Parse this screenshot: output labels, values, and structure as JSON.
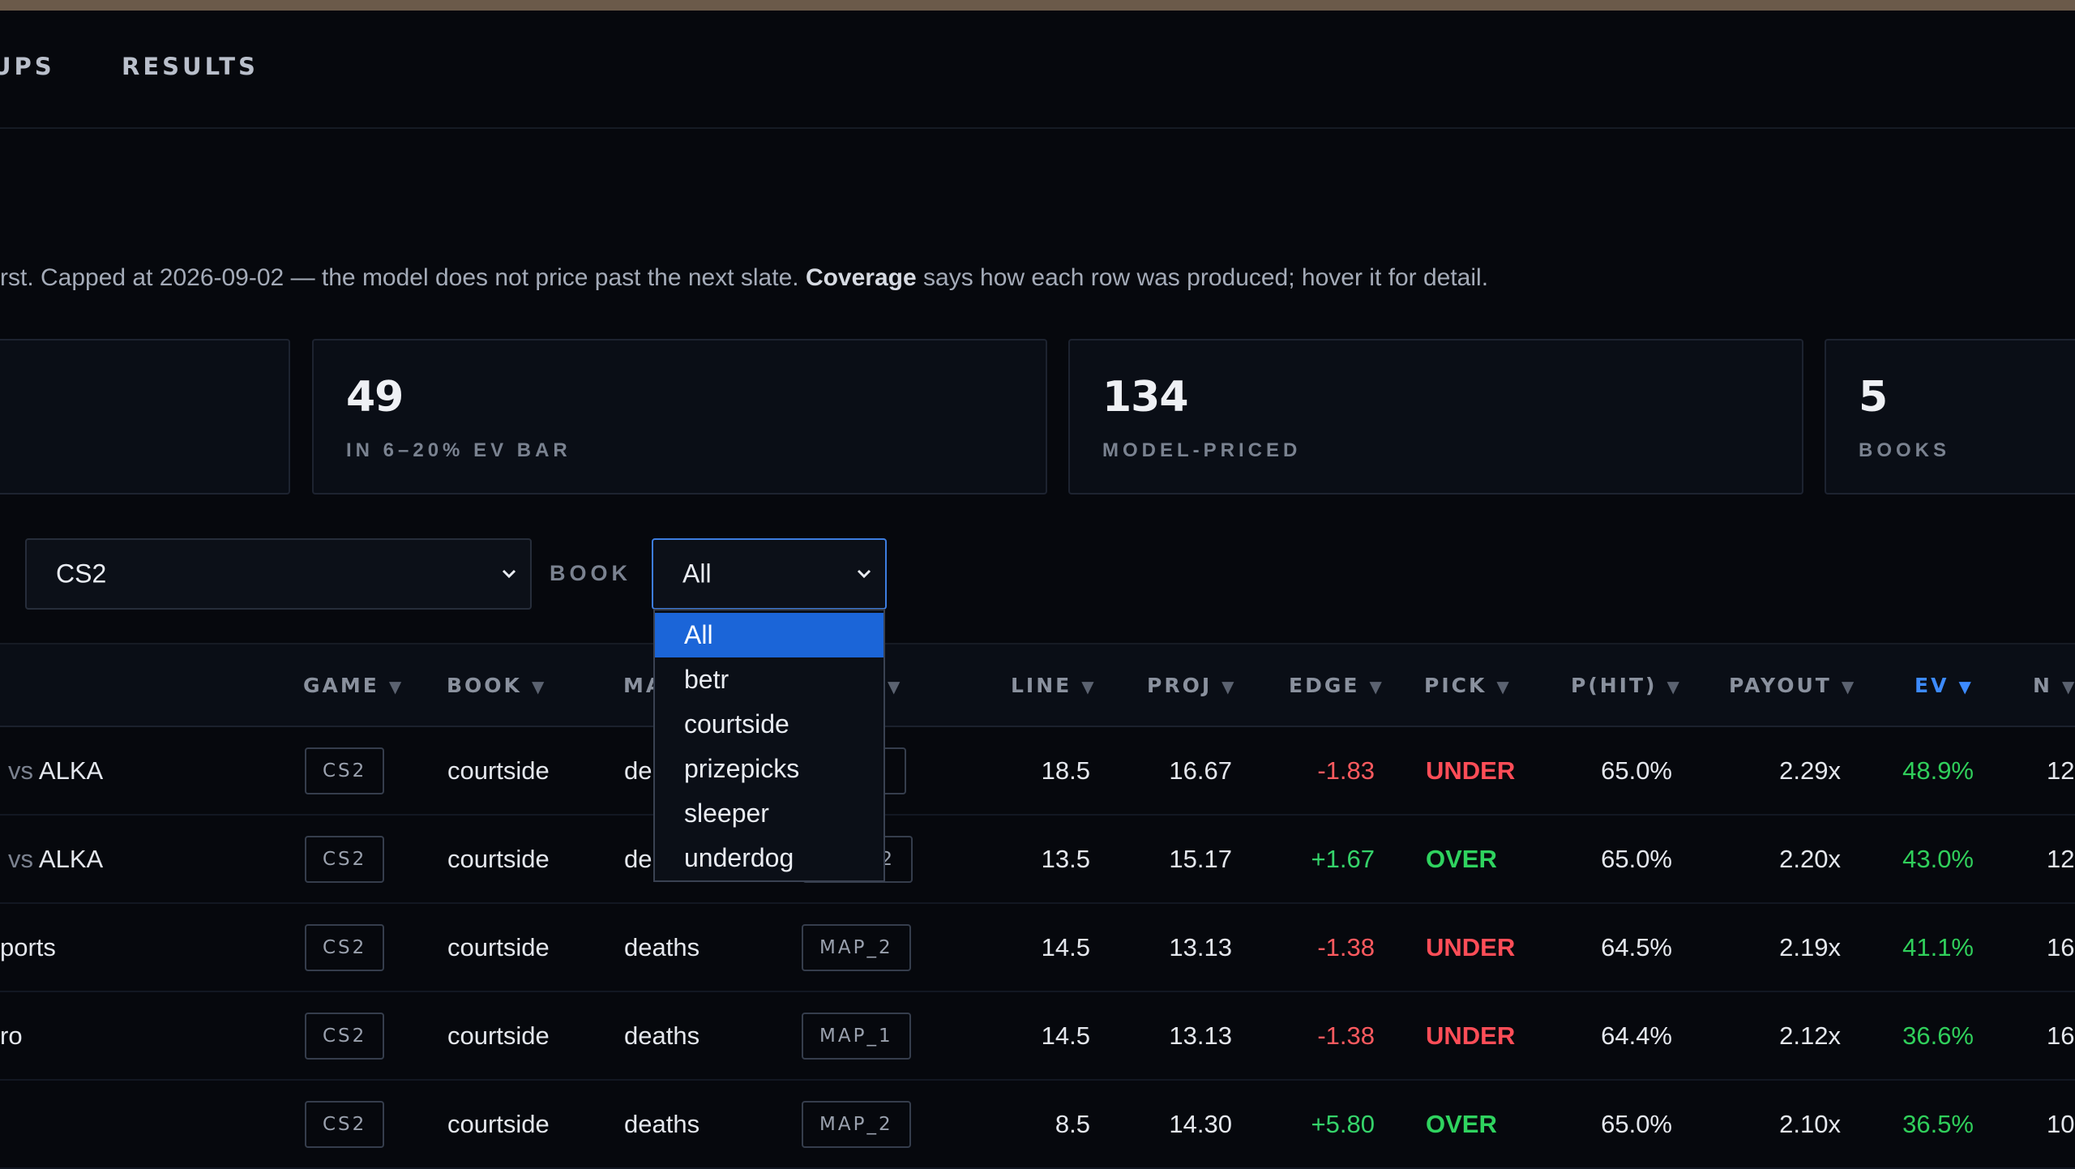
{
  "nav": {
    "item_partial": "UPS",
    "results": "RESULTS"
  },
  "intro": {
    "lead": "rst. Capped at 2026-09-02 — the model does not price past the next slate. ",
    "bold": "Coverage",
    "tail": " says how each row was produced; hover it for detail."
  },
  "stats": [
    {
      "value": "49",
      "label": "IN 6–20% EV BAR"
    },
    {
      "value": "134",
      "label": "MODEL-PRICED"
    },
    {
      "value": "5",
      "label": "BOOKS"
    }
  ],
  "filters": {
    "game_value": "CS2",
    "book_label": "BOOK",
    "book_value": "All",
    "book_options": [
      "All",
      "betr",
      "courtside",
      "prizepicks",
      "sleeper",
      "underdog"
    ]
  },
  "columns": [
    "GAME",
    "BOOK",
    "MA",
    "LINE",
    "PROJ",
    "EDGE",
    "PICK",
    "P(HIT)",
    "PAYOUT",
    "EV",
    "N"
  ],
  "rows": [
    {
      "match_muted": "vs",
      "match": "ALKA",
      "game": "CS2",
      "book": "courtside",
      "market": "de",
      "scope": "",
      "line": "18.5",
      "proj": "16.67",
      "edge": "-1.83",
      "pick": "UNDER",
      "phit": "65.0%",
      "payout": "2.29x",
      "ev": "48.9%",
      "n": "12"
    },
    {
      "match_muted": "vs",
      "match": "ALKA",
      "game": "CS2",
      "book": "courtside",
      "market": "de",
      "scope": "2",
      "line": "13.5",
      "proj": "15.17",
      "edge": "+1.67",
      "pick": "OVER",
      "phit": "65.0%",
      "payout": "2.20x",
      "ev": "43.0%",
      "n": "12"
    },
    {
      "match_muted": "",
      "match": "ports",
      "game": "CS2",
      "book": "courtside",
      "market": "deaths",
      "scope": "MAP_2",
      "line": "14.5",
      "proj": "13.13",
      "edge": "-1.38",
      "pick": "UNDER",
      "phit": "64.5%",
      "payout": "2.19x",
      "ev": "41.1%",
      "n": "16"
    },
    {
      "match_muted": "",
      "match": "ro",
      "game": "CS2",
      "book": "courtside",
      "market": "deaths",
      "scope": "MAP_1",
      "line": "14.5",
      "proj": "13.13",
      "edge": "-1.38",
      "pick": "UNDER",
      "phit": "64.4%",
      "payout": "2.12x",
      "ev": "36.6%",
      "n": "16"
    },
    {
      "match_muted": "",
      "match": "",
      "game": "CS2",
      "book": "courtside",
      "market": "deaths",
      "scope": "MAP_2",
      "line": "8.5",
      "proj": "14.30",
      "edge": "+5.80",
      "pick": "OVER",
      "phit": "65.0%",
      "payout": "2.10x",
      "ev": "36.5%",
      "n": "10"
    }
  ],
  "colors": {
    "background": "#06080d",
    "accent": "#1b65d8",
    "sorted": "#3d8bff",
    "positive": "#35d36a",
    "negative": "#ff5a5f"
  }
}
